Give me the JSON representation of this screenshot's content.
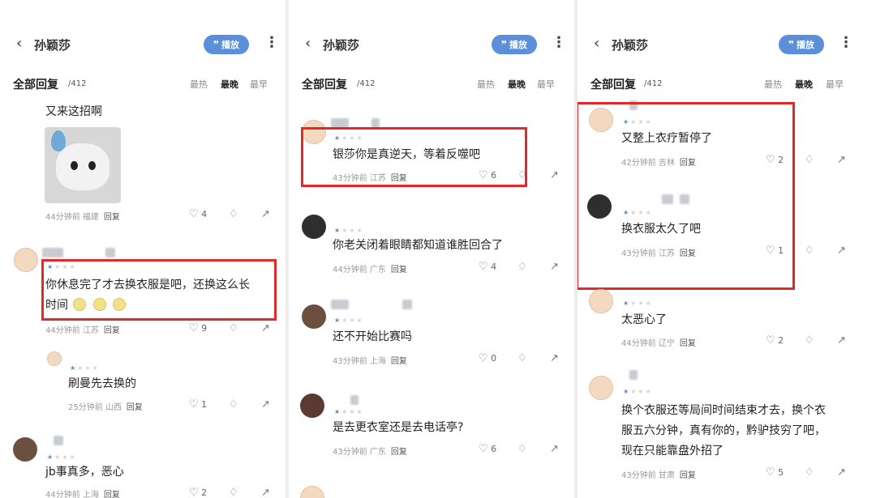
{
  "panels": [
    {
      "header": {
        "back": "‹",
        "title": "孙颖莎",
        "pill": "播放",
        "more": "⋮"
      },
      "tabs": {
        "all": "全部回复",
        "count": "/412",
        "hot": "最热",
        "new": "最晚",
        "old": "最早"
      },
      "comments": [
        {
          "text": "又来这招啊",
          "meta_time": "44分钟前",
          "meta_loc": "福建",
          "reply": "回复",
          "likes": "4"
        },
        {
          "text1": "你休息完了才去换衣服是吧，还换这么长",
          "text2": "时间",
          "meta_time": "44分钟前",
          "meta_loc": "江苏",
          "reply": "回复",
          "likes": "9"
        },
        {
          "text": "刷曼先去换的",
          "meta_time": "25分钟前",
          "meta_loc": "山西",
          "reply": "回复",
          "likes": "1"
        },
        {
          "text": "jb事真多，恶心",
          "meta_time": "44分钟前",
          "meta_loc": "上海",
          "reply": "回复",
          "likes": "2"
        }
      ]
    },
    {
      "header": {
        "back": "‹",
        "title": "孙颖莎",
        "pill": "播放",
        "more": "⋮"
      },
      "tabs": {
        "all": "全部回复",
        "count": "/412",
        "hot": "最热",
        "new": "最晚",
        "old": "最早"
      },
      "comments": [
        {
          "text": "银莎你是真逆天，等着反噬吧",
          "meta_time": "43分钟前",
          "meta_loc": "江苏",
          "reply": "回复",
          "likes": "6"
        },
        {
          "text": "你老关闭着眼睛都知道谁胜回合了",
          "meta_time": "44分钟前",
          "meta_loc": "广东",
          "reply": "回复",
          "likes": "4"
        },
        {
          "text": "还不开始比赛吗",
          "meta_time": "43分钟前",
          "meta_loc": "上海",
          "reply": "回复",
          "likes": "0"
        },
        {
          "text": "是去更衣室还是去电话亭?",
          "meta_time": "43分钟前",
          "meta_loc": "广东",
          "reply": "回复",
          "likes": "6"
        }
      ]
    },
    {
      "header": {
        "back": "‹",
        "title": "孙颖莎",
        "pill": "播放",
        "more": "⋮"
      },
      "tabs": {
        "all": "全部回复",
        "count": "/412",
        "hot": "最热",
        "new": "最晚",
        "old": "最早"
      },
      "comments": [
        {
          "text": "又整上衣疗暂停了",
          "meta_time": "42分钟前",
          "meta_loc": "吉林",
          "reply": "回复",
          "likes": "2"
        },
        {
          "text": "换衣服太久了吧",
          "meta_time": "43分钟前",
          "meta_loc": "江苏",
          "reply": "回复",
          "likes": "1"
        },
        {
          "text": "太恶心了",
          "meta_time": "44分钟前",
          "meta_loc": "辽宁",
          "reply": "回复",
          "likes": "2"
        },
        {
          "text1": "换个衣服还等局间时间结束才去，换个衣",
          "text2": "服五六分钟，真有你的，黔驴技穷了吧，",
          "text3": "现在只能靠盘外招了",
          "meta_time": "43分钟前",
          "meta_loc": "甘肃",
          "reply": "回复",
          "likes": "5"
        }
      ]
    }
  ],
  "colors": {
    "accent": "#5b8fd9",
    "highlight": "#e02a2a"
  },
  "icons": {
    "like": "thumb-up-icon",
    "dislike": "thumb-down-icon",
    "share": "share-icon",
    "back": "back-arrow-icon",
    "more": "more-vert-icon"
  }
}
